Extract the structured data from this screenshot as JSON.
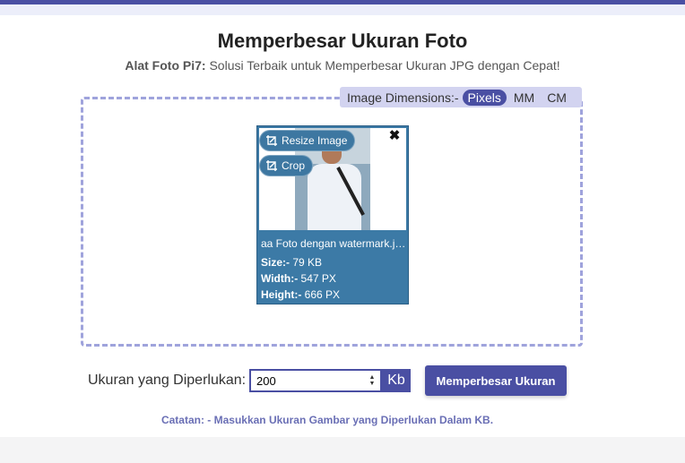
{
  "header": {
    "title": "Memperbesar Ukuran Foto",
    "subtitle_brand": "Alat Foto Pi7:",
    "subtitle_text": "Solusi Terbaik untuk Memperbesar Ukuran JPG dengan Cepat!"
  },
  "dimensions": {
    "label": "Image Dimensions:-",
    "options": [
      "Pixels",
      "MM",
      "CM"
    ],
    "selected": "Pixels"
  },
  "thumbnail": {
    "resize_label": "Resize Image",
    "crop_label": "Crop",
    "close_symbol": "✖",
    "filename": "aa Foto dengan watermark.jpg",
    "size_label": "Size:-",
    "size_value": "79 KB",
    "width_label": "Width:-",
    "width_value": "547 PX",
    "height_label": "Height:-",
    "height_value": "666 PX"
  },
  "form": {
    "required_label": "Ukuran yang Diperlukan:",
    "size_value": "200",
    "unit": "Kb",
    "submit_label": "Memperbesar Ukuran"
  },
  "note": "Catatan: - Masukkan Ukuran Gambar yang Diperlukan Dalam KB.",
  "colors": {
    "accent": "#4a4fa3",
    "thumb_bg": "#3c7aa6",
    "dashed_border": "#9fa3dc"
  }
}
